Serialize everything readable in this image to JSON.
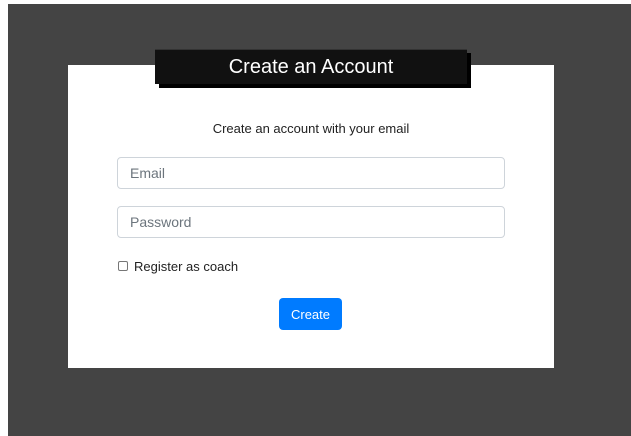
{
  "form": {
    "title": "Create an Account",
    "subtitle": "Create an account with your email",
    "email_placeholder": "Email",
    "email_value": "",
    "password_placeholder": "Password",
    "password_value": "",
    "coach_checkbox_label": "Register as coach",
    "coach_checked": false,
    "create_label": "Create"
  },
  "colors": {
    "background": "#444444",
    "card": "#ffffff",
    "title_banner": "#111111",
    "primary_button": "#007bff"
  }
}
